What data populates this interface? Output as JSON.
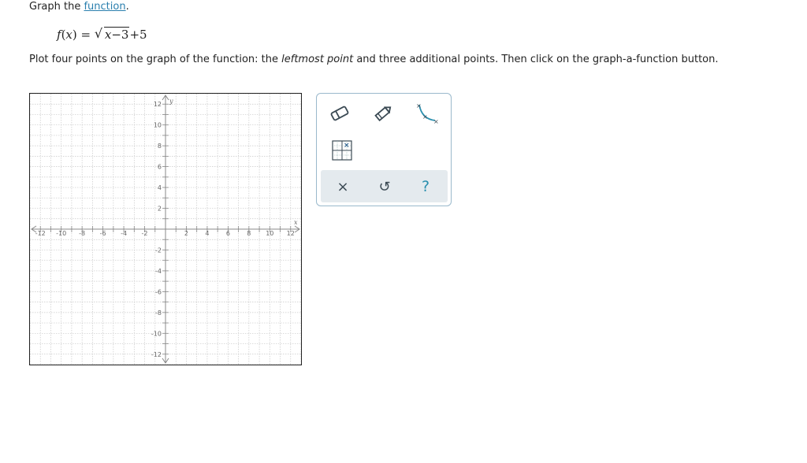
{
  "intro": {
    "prefix": "Graph the ",
    "link": "function",
    "suffix": "."
  },
  "formula": {
    "lhs_f": "f",
    "lhs_open": "(",
    "lhs_x": "x",
    "lhs_close": ")",
    "equals": "=",
    "radical": "√",
    "radicand_x": "x",
    "radicand_rest": "−3",
    "tail": "+5"
  },
  "instructions": {
    "part1": "Plot four points on the graph of the function: the ",
    "emphasis": "leftmost point",
    "part2": " and three additional points. Then click on the graph-a-function button."
  },
  "graph": {
    "x_axis_name": "x",
    "y_axis_name": "y",
    "xmin": -13,
    "xmax": 13,
    "ymin": -13,
    "ymax": 13,
    "grid": true,
    "x_tick_labels": [
      "-12",
      "-10",
      "-8",
      "-6",
      "-4",
      "-2",
      "2",
      "4",
      "6",
      "8",
      "10",
      "12"
    ],
    "y_tick_labels": [
      "12",
      "10",
      "8",
      "6",
      "4",
      "2",
      "-2",
      "-4",
      "-6",
      "-8",
      "-10",
      "-12"
    ],
    "x_tick_values": [
      -12,
      -10,
      -8,
      -6,
      -4,
      -2,
      2,
      4,
      6,
      8,
      10,
      12
    ],
    "y_tick_values": [
      12,
      10,
      8,
      6,
      4,
      2,
      -2,
      -4,
      -6,
      -8,
      -10,
      -12
    ]
  },
  "tools": {
    "eraser": "eraser-icon",
    "pencil": "pencil-icon",
    "curve": "graph-a-function-icon",
    "coordinate": "coordinate-grid-icon"
  },
  "actions": {
    "clear": "×",
    "undo": "↺",
    "help": "?"
  },
  "colors": {
    "link": "#2a7fae",
    "accent": "#2a8fae",
    "grid": "#c8c8c8",
    "panel_border": "#9ab9cc",
    "action_bg": "#e4eaee"
  }
}
